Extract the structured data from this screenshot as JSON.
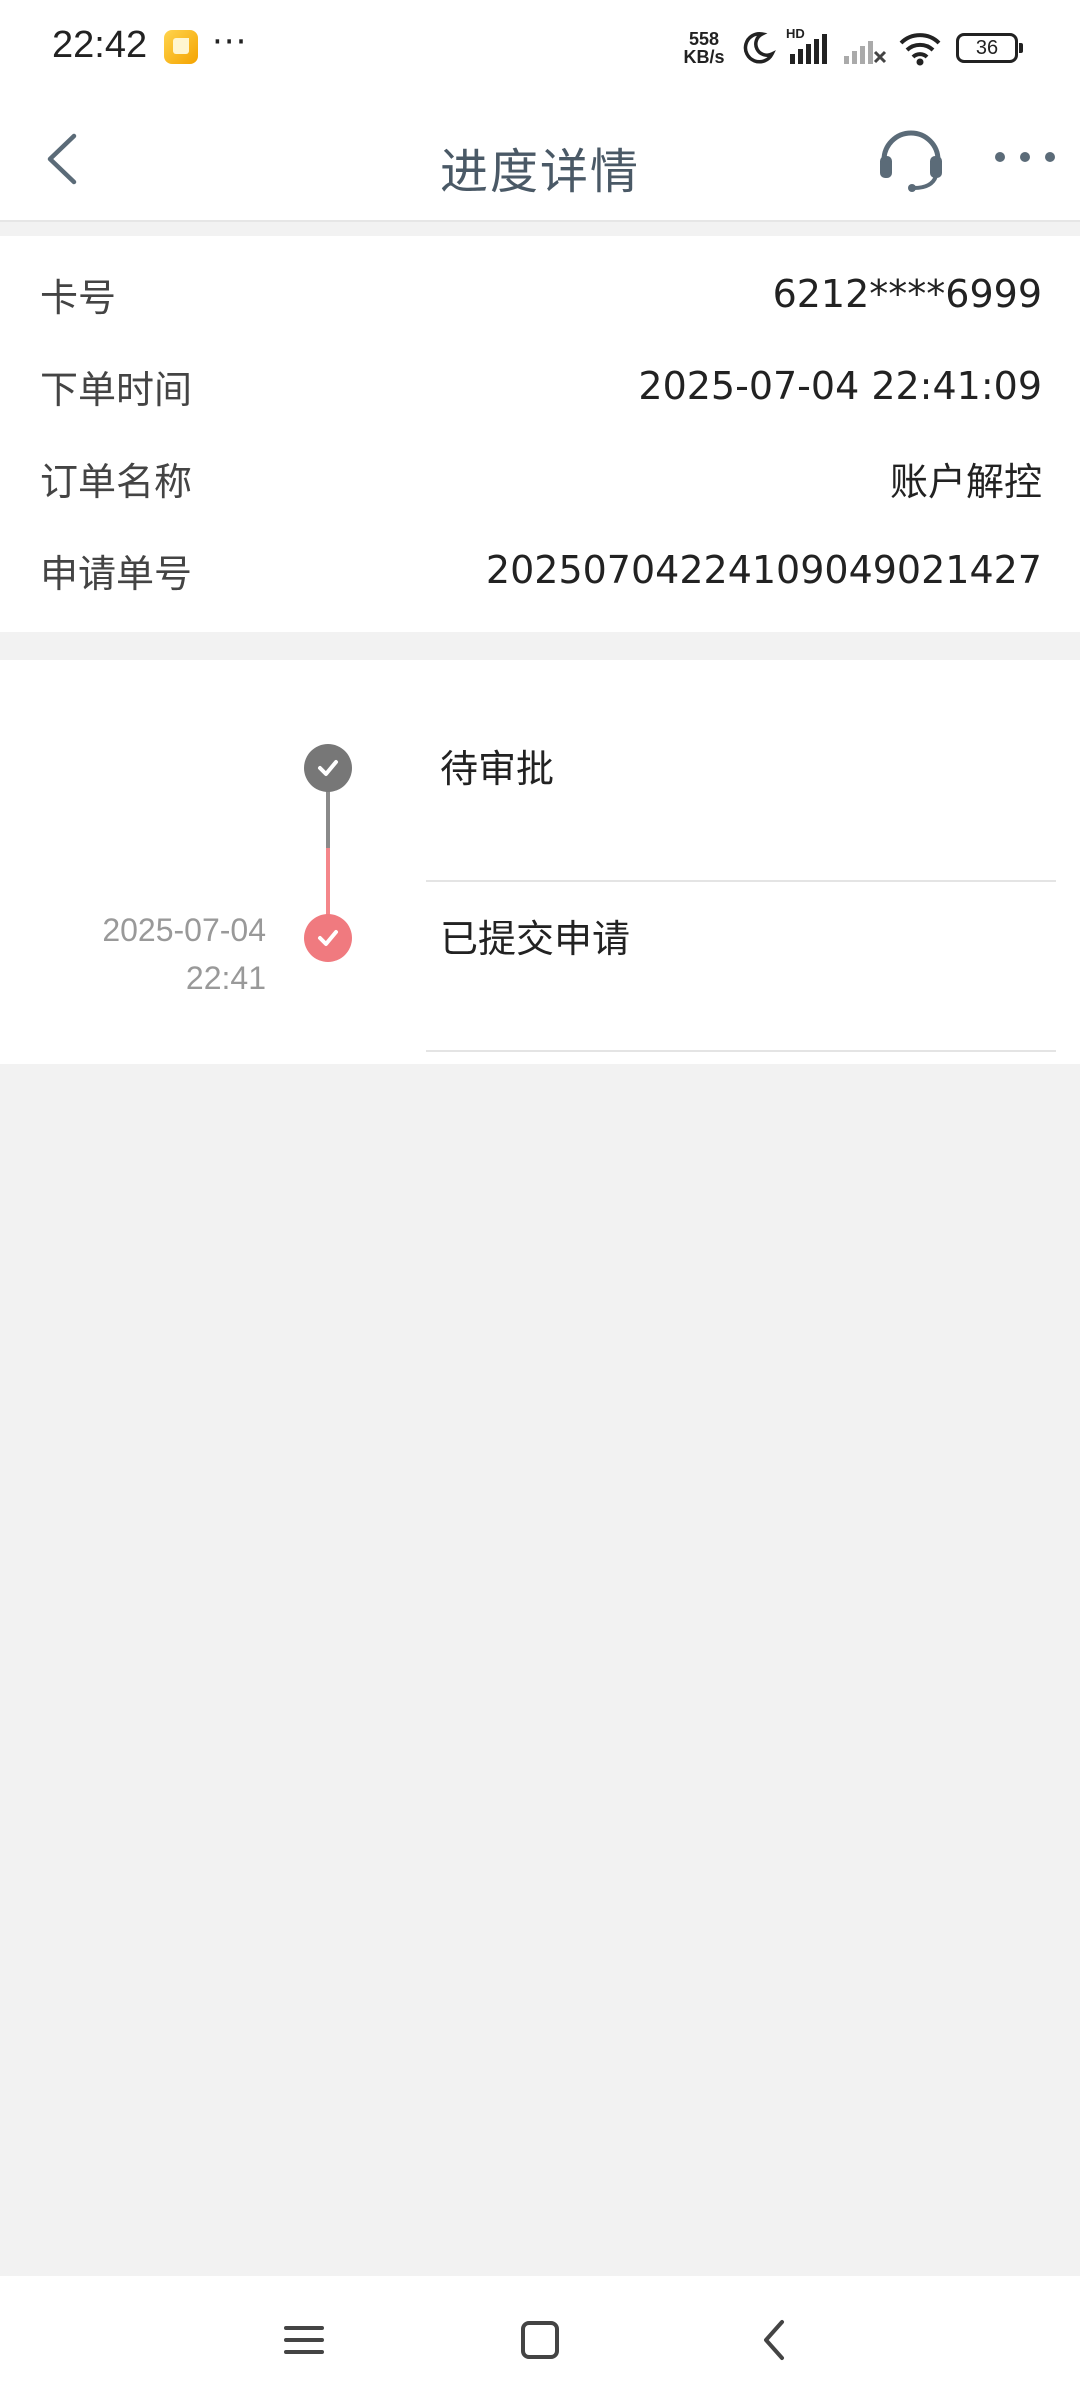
{
  "status_bar": {
    "time": "22:42",
    "more": "···",
    "net_speed_value": "558",
    "net_speed_unit": "KB/s",
    "network_type": "HD",
    "battery": "36"
  },
  "nav": {
    "title": "进度详情"
  },
  "info": {
    "rows": [
      {
        "label": "卡号",
        "value": "6212****6999"
      },
      {
        "label": "下单时间",
        "value": "2025-07-04 22:41:09"
      },
      {
        "label": "订单名称",
        "value": "账户解控"
      },
      {
        "label": "申请单号",
        "value": "20250704224109049021427"
      }
    ]
  },
  "timeline": {
    "steps": [
      {
        "title": "待审批",
        "date": "",
        "time": "",
        "status_color": "#777777"
      },
      {
        "title": "已提交申请",
        "date": "2025-07-04",
        "time": "22:41",
        "status_color": "#f07a7f"
      }
    ]
  },
  "colors": {
    "accent_red": "#f07a7f",
    "pending_gray": "#777777",
    "nav_icon": "#5b6b78"
  }
}
